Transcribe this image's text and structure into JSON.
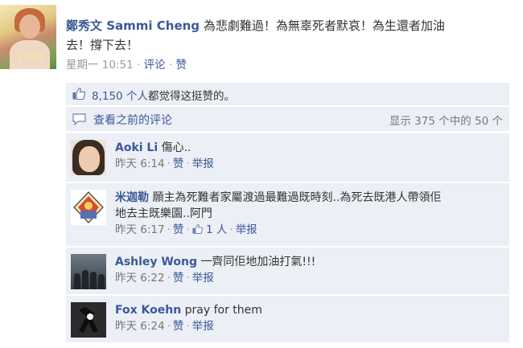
{
  "post": {
    "author": "鄭秀文 Sammi Cheng",
    "text_line1": "為悲劇難過！為無辜死者默哀！為生還者加",
    "text_line1_clipped": "油",
    "text_line2": "去！撐下去！",
    "time": "星期一 10:51",
    "sep": "·",
    "comment_link": "评论",
    "like_link": "赞",
    "avatar_logo_text": "LAM"
  },
  "likes": {
    "count": "8,150 个人",
    "suffix": "都觉得这挺赞的。"
  },
  "view": {
    "label": "查看之前的评论",
    "count_text": "显示 375 个中的 50 个"
  },
  "comments": [
    {
      "name": "Aoki Li",
      "text": "傷心..",
      "time": "昨天 6:14",
      "like": "赞",
      "report": "举报",
      "likes": ""
    },
    {
      "name": "米迦勒",
      "text": "願主為死難者家屬渡過最難過既時刻..為死去既港人帶領佢",
      "text2": "地去主既樂園..阿門",
      "time": "昨天 6:17",
      "like": "赞",
      "likes": "1 人",
      "report": "举报"
    },
    {
      "name": "Ashley Wong",
      "text": "一齊同佢地加油打氣!!!",
      "time": "昨天 6:22",
      "like": "赞",
      "report": "举报",
      "likes": ""
    },
    {
      "name": "Fox Koehn",
      "text": "pray for them",
      "time": "昨天 6:24",
      "like": "赞",
      "report": "举报",
      "likes": ""
    }
  ],
  "colors": {
    "link": "#3b5998",
    "panel": "#eceff5",
    "muted": "#999999"
  }
}
